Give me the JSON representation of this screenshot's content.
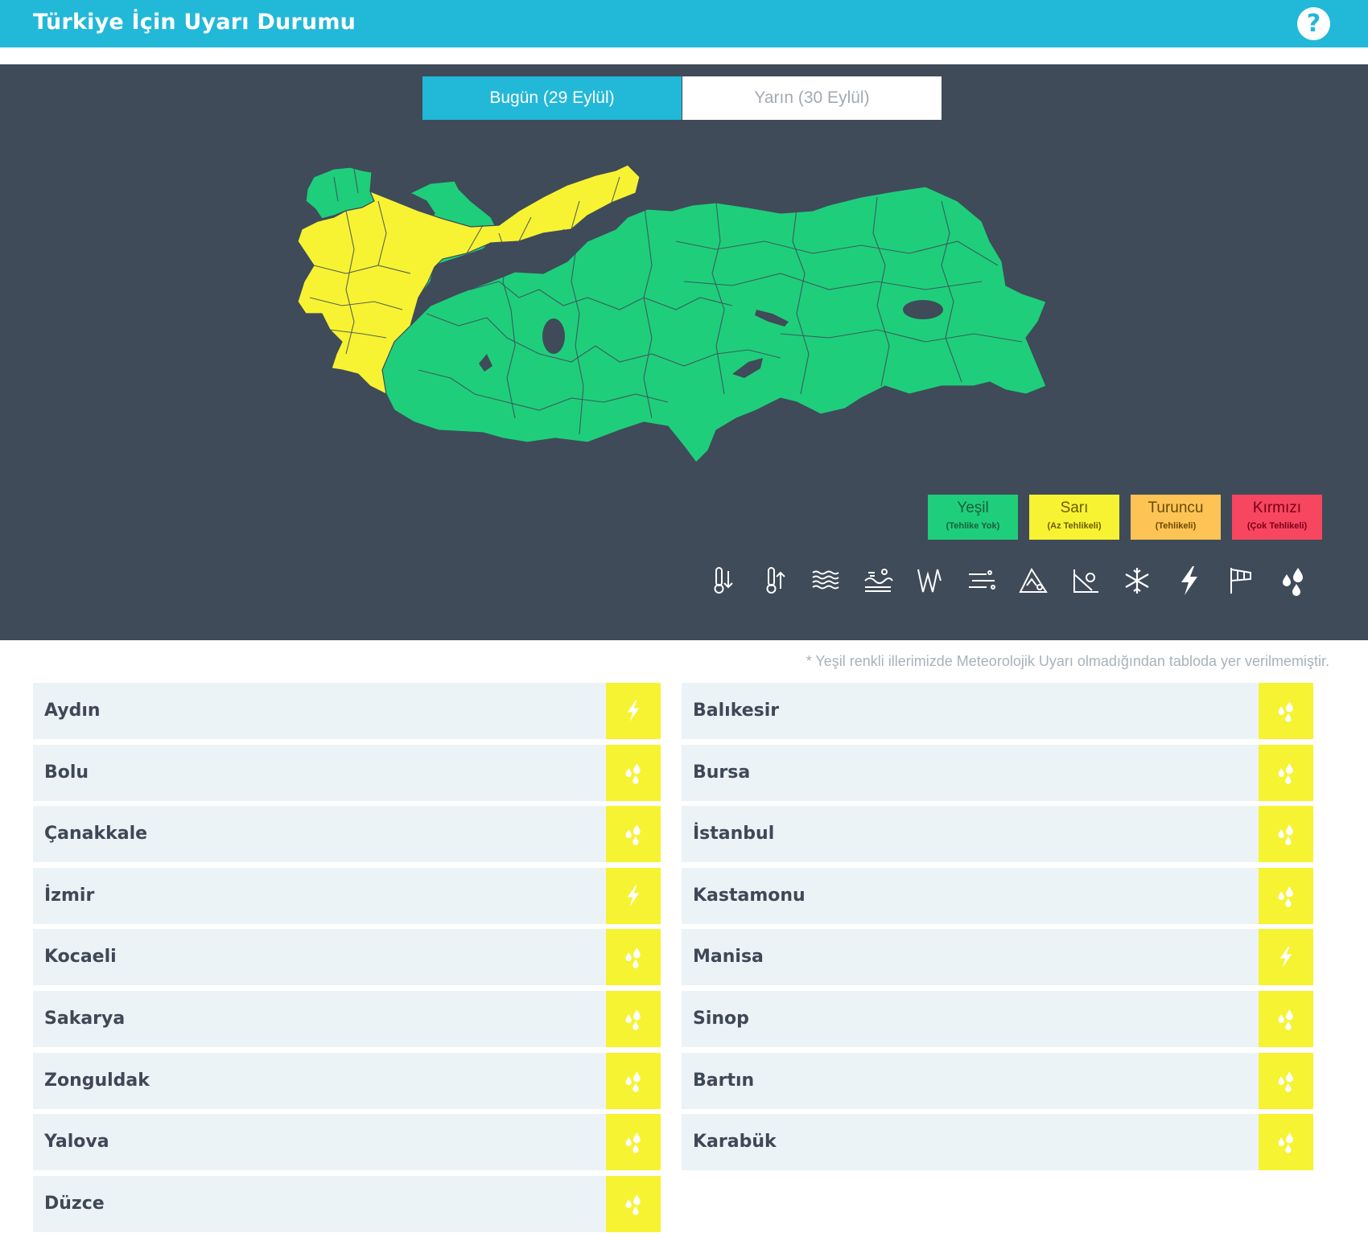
{
  "header": {
    "title": "Türkiye İçin Uyarı Durumu",
    "help_icon": "help-question-icon"
  },
  "tabs": [
    {
      "label": "Bugün (29 Eylül)",
      "active": true
    },
    {
      "label": "Yarın (30 Eylül)",
      "active": false
    }
  ],
  "legend": [
    {
      "name": "Yeşil",
      "sub": "(Tehlike Yok)",
      "bg": "#1fce7b",
      "fg": "#1a5f3c"
    },
    {
      "name": "Sarı",
      "sub": "(Az Tehlikeli)",
      "bg": "#f7f332",
      "fg": "#6b5d00"
    },
    {
      "name": "Turuncu",
      "sub": "(Tehlikeli)",
      "bg": "#fdc455",
      "fg": "#6b4a00"
    },
    {
      "name": "Kırmızı",
      "sub": "(Çok Tehlikeli)",
      "bg": "#f7465f",
      "fg": "#7a0018"
    }
  ],
  "hazard_icons": [
    "cold-icon",
    "hot-icon",
    "fog-icon",
    "dust-icon",
    "wind-icon",
    "snow-storm-icon",
    "avalanche-icon",
    "landslide-icon",
    "snowflake-icon",
    "lightning-icon",
    "windsock-icon",
    "rain-icon"
  ],
  "map": {
    "colors": {
      "green": "#1fce7b",
      "yellow": "#f7f332",
      "border": "#3f4b59"
    }
  },
  "note": "* Yeşil renkli illerimizde Meteorolojik Uyarı olmadığından tabloda yer verilmemiştir.",
  "provinces": {
    "left": [
      {
        "name": "Aydın",
        "icon": "lightning-icon"
      },
      {
        "name": "Bolu",
        "icon": "rain-icon"
      },
      {
        "name": "Çanakkale",
        "icon": "rain-icon"
      },
      {
        "name": "İzmir",
        "icon": "lightning-icon"
      },
      {
        "name": "Kocaeli",
        "icon": "rain-icon"
      },
      {
        "name": "Sakarya",
        "icon": "rain-icon"
      },
      {
        "name": "Zonguldak",
        "icon": "rain-icon"
      },
      {
        "name": "Yalova",
        "icon": "rain-icon"
      },
      {
        "name": "Düzce",
        "icon": "rain-icon"
      }
    ],
    "right": [
      {
        "name": "Balıkesir",
        "icon": "rain-icon"
      },
      {
        "name": "Bursa",
        "icon": "rain-icon"
      },
      {
        "name": "İstanbul",
        "icon": "rain-icon"
      },
      {
        "name": "Kastamonu",
        "icon": "rain-icon"
      },
      {
        "name": "Manisa",
        "icon": "lightning-icon"
      },
      {
        "name": "Sinop",
        "icon": "rain-icon"
      },
      {
        "name": "Bartın",
        "icon": "rain-icon"
      },
      {
        "name": "Karabük",
        "icon": "rain-icon"
      }
    ]
  }
}
